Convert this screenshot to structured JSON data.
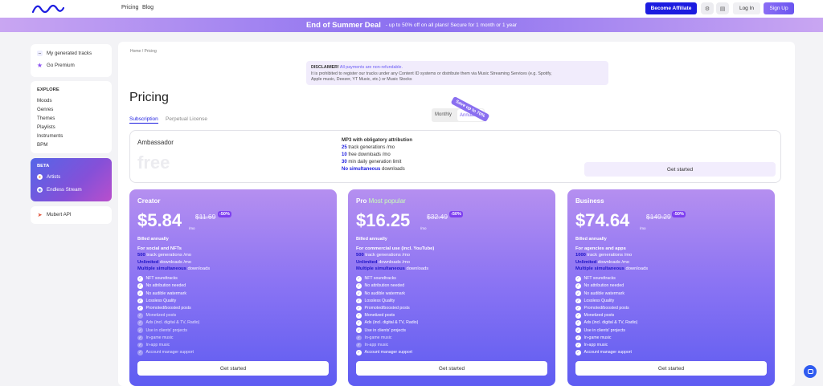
{
  "nav": {
    "links": [
      "Pricing",
      "Blog"
    ],
    "affiliate_label": "Become Affiliate",
    "login_label": "Log In",
    "signup_label": "Sign Up"
  },
  "promo": {
    "title": "End of Summer Deal",
    "text": "- up to 50% off on all plans! Secure for 1 month or 1 year"
  },
  "sidebar": {
    "top": [
      {
        "label": "My generated tracks",
        "icon": "waveform-icon"
      },
      {
        "label": "Go Premium",
        "icon": "star-icon"
      }
    ],
    "explore_heading": "EXPLORE",
    "explore": [
      "Moods",
      "Genres",
      "Themes",
      "Playlists",
      "Instruments",
      "BPM"
    ],
    "beta_heading": "BETA",
    "beta": [
      {
        "label": "Artists",
        "icon": "artist-icon"
      },
      {
        "label": "Endless Stream",
        "icon": "radio-icon"
      }
    ],
    "api": {
      "label": "Mubert API",
      "icon": "rocket-icon"
    }
  },
  "main": {
    "breadcrumb": "Home / Pricing",
    "disclaimer": {
      "heading": "DISCLAIMER!",
      "highlight": "All payments are non-refundable.",
      "line1": "It is prohibited to register our tracks under any Content ID systems or distribute them via Music Streaming Services (e.g. Spotify,",
      "line2": "Apple music, Deezer, YT Music, etc.) or Music Stocks"
    },
    "title": "Pricing",
    "tabs": [
      "Subscription",
      "Perpetual License"
    ],
    "toggle": {
      "monthly": "Monthly",
      "annual": "Annual",
      "badge": "Save up to 70%"
    }
  },
  "ambassador": {
    "name": "Ambassador",
    "price": "free",
    "heading": "MP3 with obligatory attribution",
    "features": [
      {
        "bold": "25",
        "text": " track generations /mo"
      },
      {
        "bold": "10",
        "text": " free downloads /mo"
      },
      {
        "bold": "30",
        "text": " min daily generation limit"
      },
      {
        "bold": "No simultaneous",
        "text": " downloads"
      }
    ],
    "cta": "Get started"
  },
  "plans": [
    {
      "name": "Creator",
      "popular": "",
      "price": "$5.84",
      "per": "/mo",
      "old_price": "$11.69",
      "discount": "-50%",
      "billed": "Billed annually",
      "for": "For social and NFTs",
      "quotas": [
        {
          "bold": "500",
          "text": " track generations /mo"
        },
        {
          "bold": "Unlimited",
          "text": " downloads /mo"
        },
        {
          "bold": "Multiple simultaneous",
          "text": " downloads"
        }
      ],
      "features": [
        {
          "label": "NFT soundtracks",
          "on": true
        },
        {
          "label": "No attribution needed",
          "on": true
        },
        {
          "label": "No audible watermark",
          "on": true
        },
        {
          "label": "Lossless Quality",
          "on": true
        },
        {
          "label": "Promoted/boosted posts",
          "on": true
        },
        {
          "label": "Monetized posts",
          "on": false
        },
        {
          "label": "Ads (incl. digital & TV, Radio)",
          "on": false
        },
        {
          "label": "Use in clients' projects",
          "on": false
        },
        {
          "label": "In-game music",
          "on": false
        },
        {
          "label": "In-app music",
          "on": false
        },
        {
          "label": "Account manager support",
          "on": false
        }
      ],
      "cta": "Get started"
    },
    {
      "name": "Pro",
      "popular": "Most popular",
      "price": "$16.25",
      "per": "/mo",
      "old_price": "$32.49",
      "discount": "-50%",
      "billed": "Billed annually",
      "for": "For commercial use (incl. YouTube)",
      "quotas": [
        {
          "bold": "500",
          "text": " track generations /mo"
        },
        {
          "bold": "Unlimited",
          "text": " downloads /mo"
        },
        {
          "bold": "Multiple simultaneous",
          "text": " downloads"
        }
      ],
      "features": [
        {
          "label": "NFT soundtracks",
          "on": true
        },
        {
          "label": "No attribution needed",
          "on": true
        },
        {
          "label": "No audible watermark",
          "on": true
        },
        {
          "label": "Lossless Quality",
          "on": true
        },
        {
          "label": "Promoted/boosted posts",
          "on": true
        },
        {
          "label": "Monetized posts",
          "on": true
        },
        {
          "label": "Ads (incl. digital & TV, Radio)",
          "on": true
        },
        {
          "label": "Use in clients' projects",
          "on": true
        },
        {
          "label": "In-game music",
          "on": false
        },
        {
          "label": "In-app music",
          "on": false
        },
        {
          "label": "Account manager support",
          "on": true
        }
      ],
      "cta": "Get started"
    },
    {
      "name": "Business",
      "popular": "",
      "price": "$74.64",
      "per": "/mo",
      "old_price": "$149.29",
      "discount": "-50%",
      "billed": "Billed annually",
      "for": "For agencies and apps",
      "quotas": [
        {
          "bold": "1000",
          "text": " track generations /mo"
        },
        {
          "bold": "Unlimited",
          "text": " downloads /mo"
        },
        {
          "bold": "Multiple simultaneous",
          "text": " downloads"
        }
      ],
      "features": [
        {
          "label": "NFT soundtracks",
          "on": true
        },
        {
          "label": "No attribution needed",
          "on": true
        },
        {
          "label": "No audible watermark",
          "on": true
        },
        {
          "label": "Lossless Quality",
          "on": true
        },
        {
          "label": "Promoted/boosted posts",
          "on": true
        },
        {
          "label": "Monetized posts",
          "on": true
        },
        {
          "label": "Ads (incl. digital & TV, Radio)",
          "on": true
        },
        {
          "label": "Use in clients' projects",
          "on": true
        },
        {
          "label": "In-game music",
          "on": true
        },
        {
          "label": "In-app music",
          "on": true
        },
        {
          "label": "Account manager support",
          "on": true
        }
      ],
      "cta": "Get started"
    }
  ],
  "colors": {
    "accent": "#1c1ce0",
    "brand_purple": "#8a6ff0"
  }
}
